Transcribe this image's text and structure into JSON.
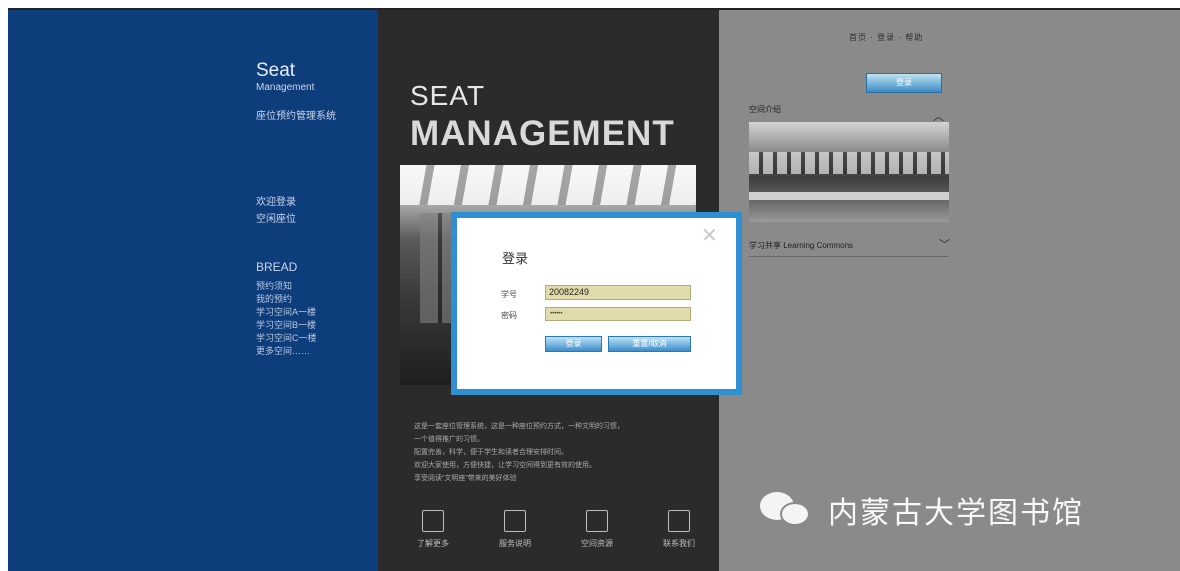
{
  "blue_panel": {
    "title_line1": "Seat",
    "title_line2": "Management",
    "title_line3": "座位预约管理系统",
    "section1_title": "欢迎登录",
    "section1_sub": "空闲座位",
    "list_head": "BREAD",
    "list_items": [
      "预约须知",
      "我的预约",
      "学习空间A一楼",
      "学习空间B一楼",
      "学习空间C一楼",
      "更多空间……"
    ]
  },
  "dark_panel": {
    "heading1": "SEAT",
    "heading2": "MANAGEMENT",
    "text_lines": [
      "这是一套座位管理系统，这是一种座位预约方式，一种文明的习惯，",
      "一个值得推广的习惯。",
      "配置完善，科学，便于学生和读者合理安排时间。",
      "欢迎大家使用，方便快捷，让学习空间得到更有效的使用。",
      "享受阅读“文明座”带来的美好体验"
    ],
    "icons": [
      {
        "icon": "clipboard-icon",
        "label": "了解更多"
      },
      {
        "icon": "document-icon",
        "label": "服务说明"
      },
      {
        "icon": "building-icon",
        "label": "空间资源"
      },
      {
        "icon": "monitor-icon",
        "label": "联系我们"
      }
    ]
  },
  "gray_panel": {
    "nav": "首页 · 登录 · 帮助",
    "button_label": "登录",
    "row1_label": "空间介绍",
    "row2_label": "学习共享 Learning Commons"
  },
  "watermark": {
    "text": "内蒙古大学图书馆",
    "icon": "wechat-icon"
  },
  "login_dialog": {
    "title": "登录",
    "close_icon": "close-icon",
    "label_account": "学号",
    "value_account": "20082249",
    "label_password": "密码",
    "value_password": "••••••",
    "button_login": "登录",
    "button_reset": "重置/取消"
  },
  "colors": {
    "blue_panel": "#0e3d7c",
    "dark_panel": "#2b2b2b",
    "gray_panel": "#8a8a8a",
    "dialog_border": "#2e8fd2",
    "input_bg": "#e2dcaa"
  }
}
